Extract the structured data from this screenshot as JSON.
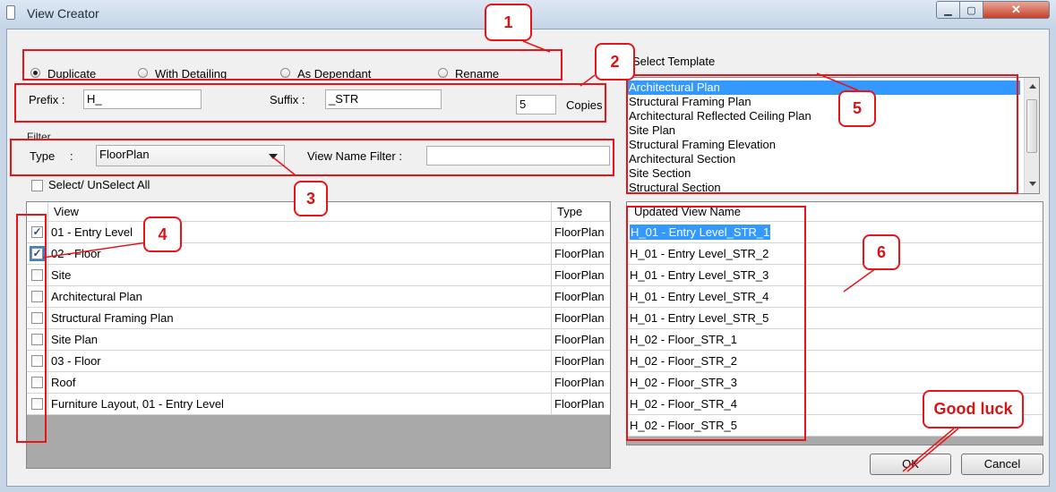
{
  "window": {
    "title": "View Creator",
    "close_glyph": "✕",
    "min_glyph": "▁",
    "max_glyph": "▢"
  },
  "mode": {
    "options": [
      "Duplicate",
      "With Detailing",
      "As Dependant",
      "Rename"
    ],
    "selected": "Duplicate"
  },
  "naming": {
    "prefix_label": "Prefix :",
    "prefix_value": "H_",
    "suffix_label": "Suffix :",
    "suffix_value": "_STR",
    "copies_value": "5",
    "copies_label": "Copies"
  },
  "filter": {
    "group_label": "Filter",
    "type_label": "Type",
    "type_colon": ":",
    "type_value": "FloorPlan",
    "view_name_filter_label": "View Name Filter :",
    "view_name_filter_value": "",
    "select_all_label": "Select/ UnSelect All"
  },
  "views_table": {
    "headers": {
      "view": "View",
      "type": "Type"
    },
    "rows": [
      {
        "checked": true,
        "view": "01 - Entry Level",
        "type": "FloorPlan"
      },
      {
        "checked": true,
        "view": "02 - Floor",
        "type": "FloorPlan"
      },
      {
        "checked": false,
        "view": "Site",
        "type": "FloorPlan"
      },
      {
        "checked": false,
        "view": "Architectural Plan",
        "type": "FloorPlan"
      },
      {
        "checked": false,
        "view": "Structural Framing Plan",
        "type": "FloorPlan"
      },
      {
        "checked": false,
        "view": "Site Plan",
        "type": "FloorPlan"
      },
      {
        "checked": false,
        "view": "03 - Floor",
        "type": "FloorPlan"
      },
      {
        "checked": false,
        "view": "Roof",
        "type": "FloorPlan"
      },
      {
        "checked": false,
        "view": "Furniture Layout,  01 - Entry Level",
        "type": "FloorPlan"
      }
    ]
  },
  "template": {
    "label": "Select Template",
    "items": [
      "Architectural Plan",
      "Structural Framing Plan",
      "Architectural Reflected Ceiling Plan",
      "Site Plan",
      "Structural Framing Elevation",
      "Architectural Section",
      "Site Section",
      "Structural Section"
    ],
    "selected_index": 0
  },
  "updated_table": {
    "header": "Updated View Name",
    "rows": [
      "H_01 - Entry Level_STR_1",
      "H_01 - Entry Level_STR_2",
      "H_01 - Entry Level_STR_3",
      "H_01 - Entry Level_STR_4",
      "H_01 - Entry Level_STR_5",
      "H_02 - Floor_STR_1",
      "H_02 - Floor_STR_2",
      "H_02 - Floor_STR_3",
      "H_02 - Floor_STR_4",
      "H_02 - Floor_STR_5"
    ]
  },
  "buttons": {
    "ok": "OK",
    "cancel": "Cancel"
  },
  "callouts": {
    "c1": "1",
    "c2": "2",
    "c3": "3",
    "c4": "4",
    "c5": "5",
    "c6": "6",
    "good_luck": "Good luck"
  },
  "colors": {
    "annotation_red": "#e8141a",
    "selection_blue": "#3399ff"
  },
  "icons": {
    "dropdown": "dropdown-arrow-icon",
    "check": "checkmark-icon",
    "scroll_up": "scroll-up-icon",
    "scroll_down": "scroll-down-icon"
  }
}
